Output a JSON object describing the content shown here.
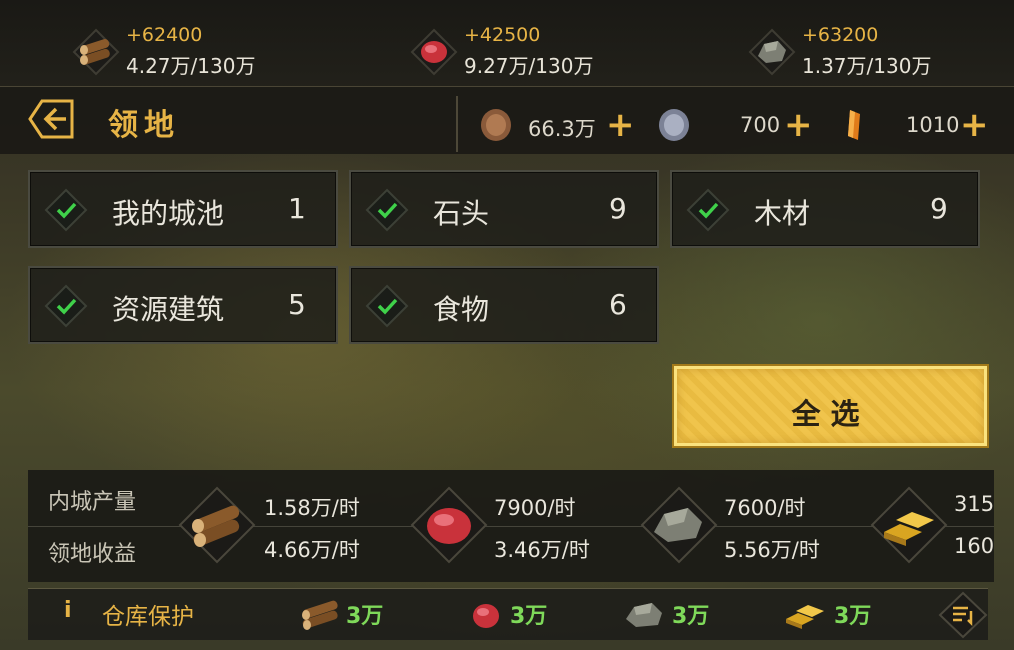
{
  "top_resources": [
    {
      "name": "wood",
      "icon": "wood-log-icon",
      "gain": "+62400",
      "amount": "4.27万/130万"
    },
    {
      "name": "meat",
      "icon": "meat-icon",
      "gain": "+42500",
      "amount": "9.27万/130万"
    },
    {
      "name": "stone",
      "icon": "stone-icon",
      "gain": "+63200",
      "amount": "1.37万/130万"
    }
  ],
  "header": {
    "title": "领地",
    "currencies": [
      {
        "name": "copper-coin",
        "icon": "copper-coin-icon",
        "value": "66.3万",
        "plus": "+"
      },
      {
        "name": "silver-coin",
        "icon": "silver-coin-icon",
        "value": "700",
        "plus": "+"
      },
      {
        "name": "gem",
        "icon": "amber-gem-icon",
        "value": "1010",
        "plus": "+"
      }
    ]
  },
  "filters": [
    {
      "label": "我的城池",
      "count": "1",
      "checked": true
    },
    {
      "label": "石头",
      "count": "9",
      "checked": true
    },
    {
      "label": "木材",
      "count": "9",
      "checked": true
    },
    {
      "label": "资源建筑",
      "count": "5",
      "checked": true
    },
    {
      "label": "食物",
      "count": "6",
      "checked": true
    }
  ],
  "select_all": "全选",
  "production": {
    "row_labels": [
      "内城产量",
      "领地收益"
    ],
    "items": [
      {
        "icon": "wood-log-icon",
        "inner": "1.58万/时",
        "territory": "4.66万/时"
      },
      {
        "icon": "meat-icon",
        "inner": "7900/时",
        "territory": "3.46万/时"
      },
      {
        "icon": "stone-icon",
        "inner": "7600/时",
        "territory": "5.56万/时"
      },
      {
        "icon": "gold-bar-icon",
        "inner": "315",
        "territory": "160"
      }
    ]
  },
  "warehouse": {
    "info": "i",
    "label": "仓库保护",
    "items": [
      {
        "icon": "wood-log-icon",
        "value": "3万"
      },
      {
        "icon": "meat-icon",
        "value": "3万"
      },
      {
        "icon": "stone-icon",
        "value": "3万"
      },
      {
        "icon": "gold-bar-icon",
        "value": "3万"
      }
    ]
  },
  "colors": {
    "accent": "#e7b446",
    "check": "#3fd14a",
    "protect_value": "#7fd95a",
    "button": "#f0c44c"
  }
}
